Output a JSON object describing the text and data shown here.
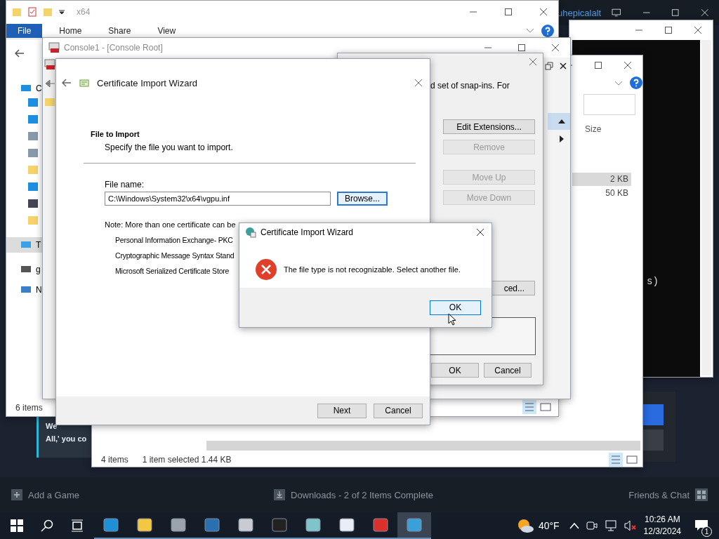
{
  "steam": {
    "account": "uhepicalalt",
    "news_lines": [
      "We",
      "All,' you co"
    ],
    "footer": {
      "add_game": "Add a Game",
      "downloads": "Downloads - 2 of 2 Items Complete",
      "friends": "Friends & Chat"
    }
  },
  "terminal": {
    "text": "s)"
  },
  "explorer_right": {
    "column": "Size",
    "rows": [
      {
        "size": "2 KB",
        "selected": true
      },
      {
        "size": "50 KB",
        "selected": false
      }
    ],
    "status_count": "4 items",
    "status_selection": "1 item selected  1.44 KB"
  },
  "explorer_left": {
    "title": "x64",
    "ribbon_tabs": [
      {
        "label": "File",
        "selected": true
      },
      {
        "label": "Home",
        "selected": false
      },
      {
        "label": "Share",
        "selected": false
      },
      {
        "label": "View",
        "selected": false
      }
    ],
    "nav_items": [
      {
        "label": "C",
        "selected": false
      },
      {
        "label": "T",
        "selected": true
      },
      {
        "label": "g",
        "selected": false
      },
      {
        "label": "N",
        "selected": false
      }
    ],
    "status": "6 items"
  },
  "console": {
    "title": "Console1 - [Console Root]"
  },
  "snapins_dialog": {
    "intro": "d set of snap-ins. For",
    "buttons": [
      {
        "label": "Edit Extensions...",
        "disabled": false
      },
      {
        "label": "Remove",
        "disabled": true
      },
      {
        "label": "Move Up",
        "disabled": true
      },
      {
        "label": "Move Down",
        "disabled": true
      }
    ],
    "advanced": "ced...",
    "ok": "OK",
    "cancel": "Cancel"
  },
  "wizard": {
    "title": "Certificate Import Wizard",
    "heading": "File to Import",
    "subheading": "Specify the file you want to import.",
    "file_label": "File name:",
    "file_value": "C:\\Windows\\System32\\x64\\vgpu.inf",
    "browse": "Browse...",
    "note": "Note:  More than one certificate can be",
    "formats": [
      "Personal Information Exchange- PKC",
      "Cryptographic Message Syntax Stand",
      "Microsoft Serialized Certificate Store"
    ],
    "next": "Next",
    "cancel": "Cancel"
  },
  "error_dialog": {
    "title": "Certificate Import Wizard",
    "message": "The file type is not recognizable. Select another file.",
    "ok": "OK"
  },
  "taskbar": {
    "apps": [
      {
        "selected": false
      },
      {
        "selected": false
      },
      {
        "selected": false
      },
      {
        "selected": false
      },
      {
        "selected": false
      },
      {
        "selected": false
      },
      {
        "selected": false
      },
      {
        "selected": false
      },
      {
        "selected": false
      },
      {
        "selected": true
      }
    ],
    "weather": "40°F",
    "time": "10:26 AM",
    "date": "12/3/2024",
    "notifications": "1"
  }
}
